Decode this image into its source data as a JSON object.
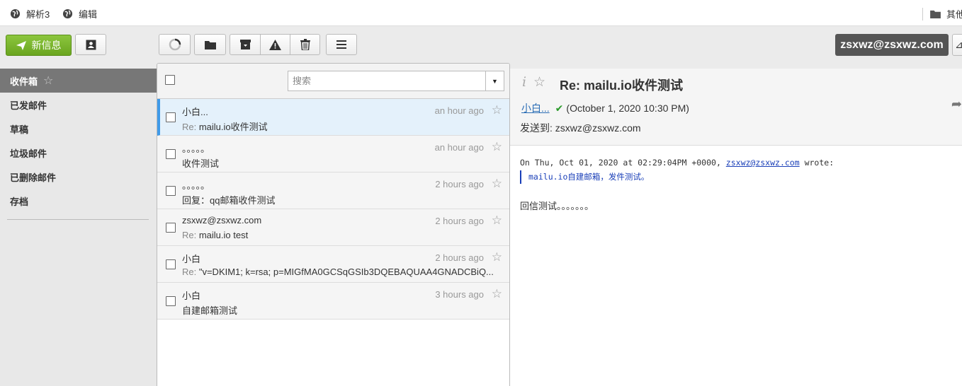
{
  "bookmarks": {
    "items": [
      {
        "label": "解析3",
        "icon": "globe-icon"
      },
      {
        "label": "编辑",
        "icon": "globe-icon"
      }
    ],
    "other_label": "其他"
  },
  "toolbar": {
    "compose_label": "新信息",
    "contacts_icon": "contact-card-icon",
    "refresh_icon": "refresh-icon",
    "move_icon": "folder-icon",
    "archive_icon": "archive-icon",
    "spam_icon": "warning-icon",
    "delete_icon": "trash-icon",
    "menu_icon": "menu-icon",
    "account": "zsxwz@zsxwz.com",
    "account_extra": "⊿"
  },
  "sidebar": {
    "folders": [
      {
        "label": "收件箱",
        "active": true
      },
      {
        "label": "已发邮件"
      },
      {
        "label": "草稿"
      },
      {
        "label": "垃圾邮件"
      },
      {
        "label": "已删除邮件"
      },
      {
        "label": "存档"
      }
    ]
  },
  "list": {
    "search_placeholder": "搜索",
    "messages": [
      {
        "from": "小白...",
        "prefix": "Re: ",
        "subject": "mailu.io收件测试",
        "date": "an hour ago",
        "selected": true
      },
      {
        "from": "。。。。。",
        "prefix": "",
        "subject": "收件测试",
        "date": "an hour ago"
      },
      {
        "from": "。。。。。",
        "prefix": "",
        "subject": "回复：qq邮箱收件测试",
        "date": "2 hours ago"
      },
      {
        "from": "zsxwz@zsxwz.com",
        "prefix": "Re: ",
        "subject": "mailu.io test",
        "date": "2 hours ago"
      },
      {
        "from": "小白",
        "prefix": "Re: ",
        "subject": "\"v=DKIM1; k=rsa; p=MIGfMA0GCSqGSIb3DQEBAQUAA4GNADCBiQ...",
        "date": "2 hours ago"
      },
      {
        "from": "小白",
        "prefix": "",
        "subject": "自建邮箱测试",
        "date": "3 hours ago"
      }
    ]
  },
  "reader": {
    "subject": "Re: mailu.io收件测试",
    "sender": "小白...",
    "date": "(October 1, 2020 10:30 PM)",
    "to_label": "发送到:",
    "to": "zsxwz@zsxwz.com",
    "quote_intro": "On Thu, Oct 01, 2020 at 02:29:04PM +0000, ",
    "quote_email": "zsxwz@zsxwz.com",
    "quote_wrote": " wrote:",
    "quote_text": "mailu.io自建邮箱，发件测试。",
    "reply_text": "回信测试。。。。。。。"
  },
  "colors": {
    "accent_green": "#7cb82f",
    "selected_row": "#e4f1fb",
    "selected_bar": "#3f9ae8",
    "active_folder": "#777777",
    "quote_blue": "#1a3fb8"
  }
}
